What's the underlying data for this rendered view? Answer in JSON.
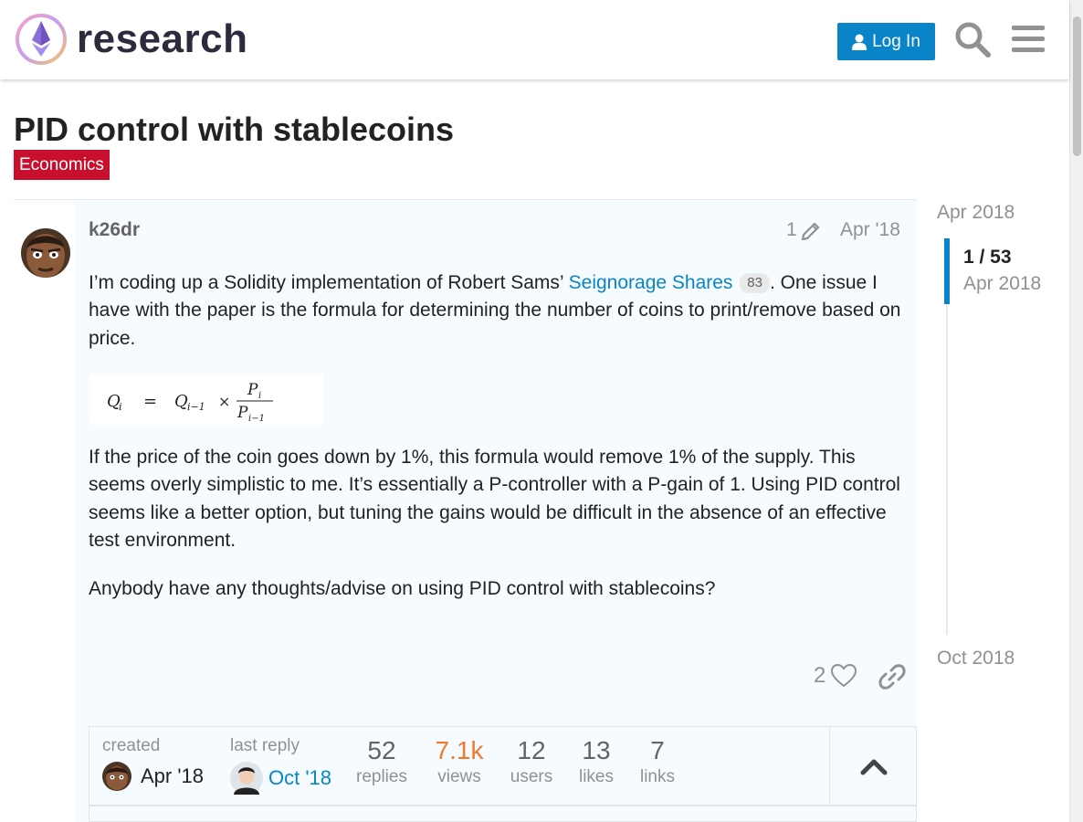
{
  "header": {
    "site_name": "research",
    "login_label": "Log In",
    "icons": [
      "site-logo",
      "user-icon",
      "search-icon",
      "hamburger-menu-icon"
    ]
  },
  "topic": {
    "title": "PID control with stablecoins",
    "category": "Economics",
    "category_color": "#c8102e"
  },
  "post": {
    "username": "k26dr",
    "edit_count": "1",
    "date": "Apr '18",
    "p1_before": "I’m coding up a Solidity implementation of Robert Sams’ ",
    "p1_link": "Seignorage Shares",
    "p1_link_clicks": "83",
    "p1_after": ". One issue I have with the paper is the formula for determining the number of coins to print/remove based on price.",
    "formula": {
      "lhs": "Q",
      "lhs_sub": "i",
      "equals": "=",
      "q_prev": "Q",
      "q_prev_sub": "i−1",
      "times": "×",
      "num": "P",
      "num_sub": "i",
      "den": "P",
      "den_sub": "i−1"
    },
    "p2": "If the price of the coin goes down by 1%, this formula would remove 1% of the supply. This seems overly simplistic to me. It’s essentially a P-controller with a P-gain of 1. Using PID control seems like a better option, but tuning the gains would be difficult in the absence of an effective test environment.",
    "p3": "Anybody have any thoughts/advise on using PID control with stablecoins?",
    "like_count": "2"
  },
  "topic_map": {
    "created_label": "created",
    "created_date": "Apr '18",
    "last_reply_label": "last reply",
    "last_reply_date": "Oct '18",
    "stats": [
      {
        "value": "52",
        "label": "replies"
      },
      {
        "value": "7.1k",
        "label": "views"
      },
      {
        "value": "12",
        "label": "users"
      },
      {
        "value": "13",
        "label": "likes"
      },
      {
        "value": "7",
        "label": "links"
      }
    ],
    "views_color": "#f0792c"
  },
  "timeline": {
    "start": "Apr 2018",
    "position": "1 / 53",
    "position_date": "Apr 2018",
    "end": "Oct 2018"
  },
  "colors": {
    "accent": "#0a84c8",
    "post_bg": "#f5fbff",
    "muted": "#919191"
  }
}
